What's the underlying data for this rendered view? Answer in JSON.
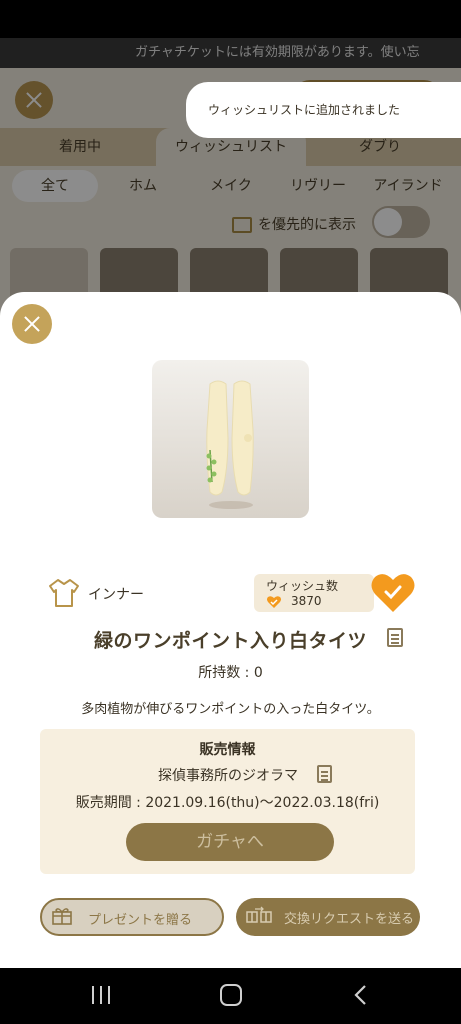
{
  "ticker": {
    "text": "ガチャチケットには有効期限があります。使い忘"
  },
  "tabs": [
    {
      "label": "着用中"
    },
    {
      "label": "ウィッシュリスト"
    },
    {
      "label": "ダブり"
    }
  ],
  "subtabs": [
    {
      "label": "全て"
    },
    {
      "label": "ホム"
    },
    {
      "label": "メイク"
    },
    {
      "label": "リヴリー"
    },
    {
      "label": "アイランド"
    }
  ],
  "priority": {
    "label": "を優先的に表示"
  },
  "toast": {
    "text": "ウィッシュリストに追加されました"
  },
  "item": {
    "category": "インナー",
    "wish_label": "ウィッシュ数",
    "wish_count": "3870",
    "title": "緑のワンポイント入り白タイツ",
    "owned": "所持数 : 0",
    "description": "多肉植物が伸びるワンポイントの入った白タイツ。"
  },
  "sales": {
    "title": "販売情報",
    "source": "探偵事務所のジオラマ",
    "period": "販売期間 : 2021.09.16(thu)〜2022.03.18(fri)",
    "gacha_button": "ガチャへ"
  },
  "actions": {
    "present": "プレゼントを贈る",
    "trade": "交換リクエストを送る"
  },
  "colors": {
    "gold": "#c4a35a",
    "brown_button": "#8c7646",
    "wish_heart": "#f39a1e",
    "sales_bg": "#f7efdf"
  }
}
